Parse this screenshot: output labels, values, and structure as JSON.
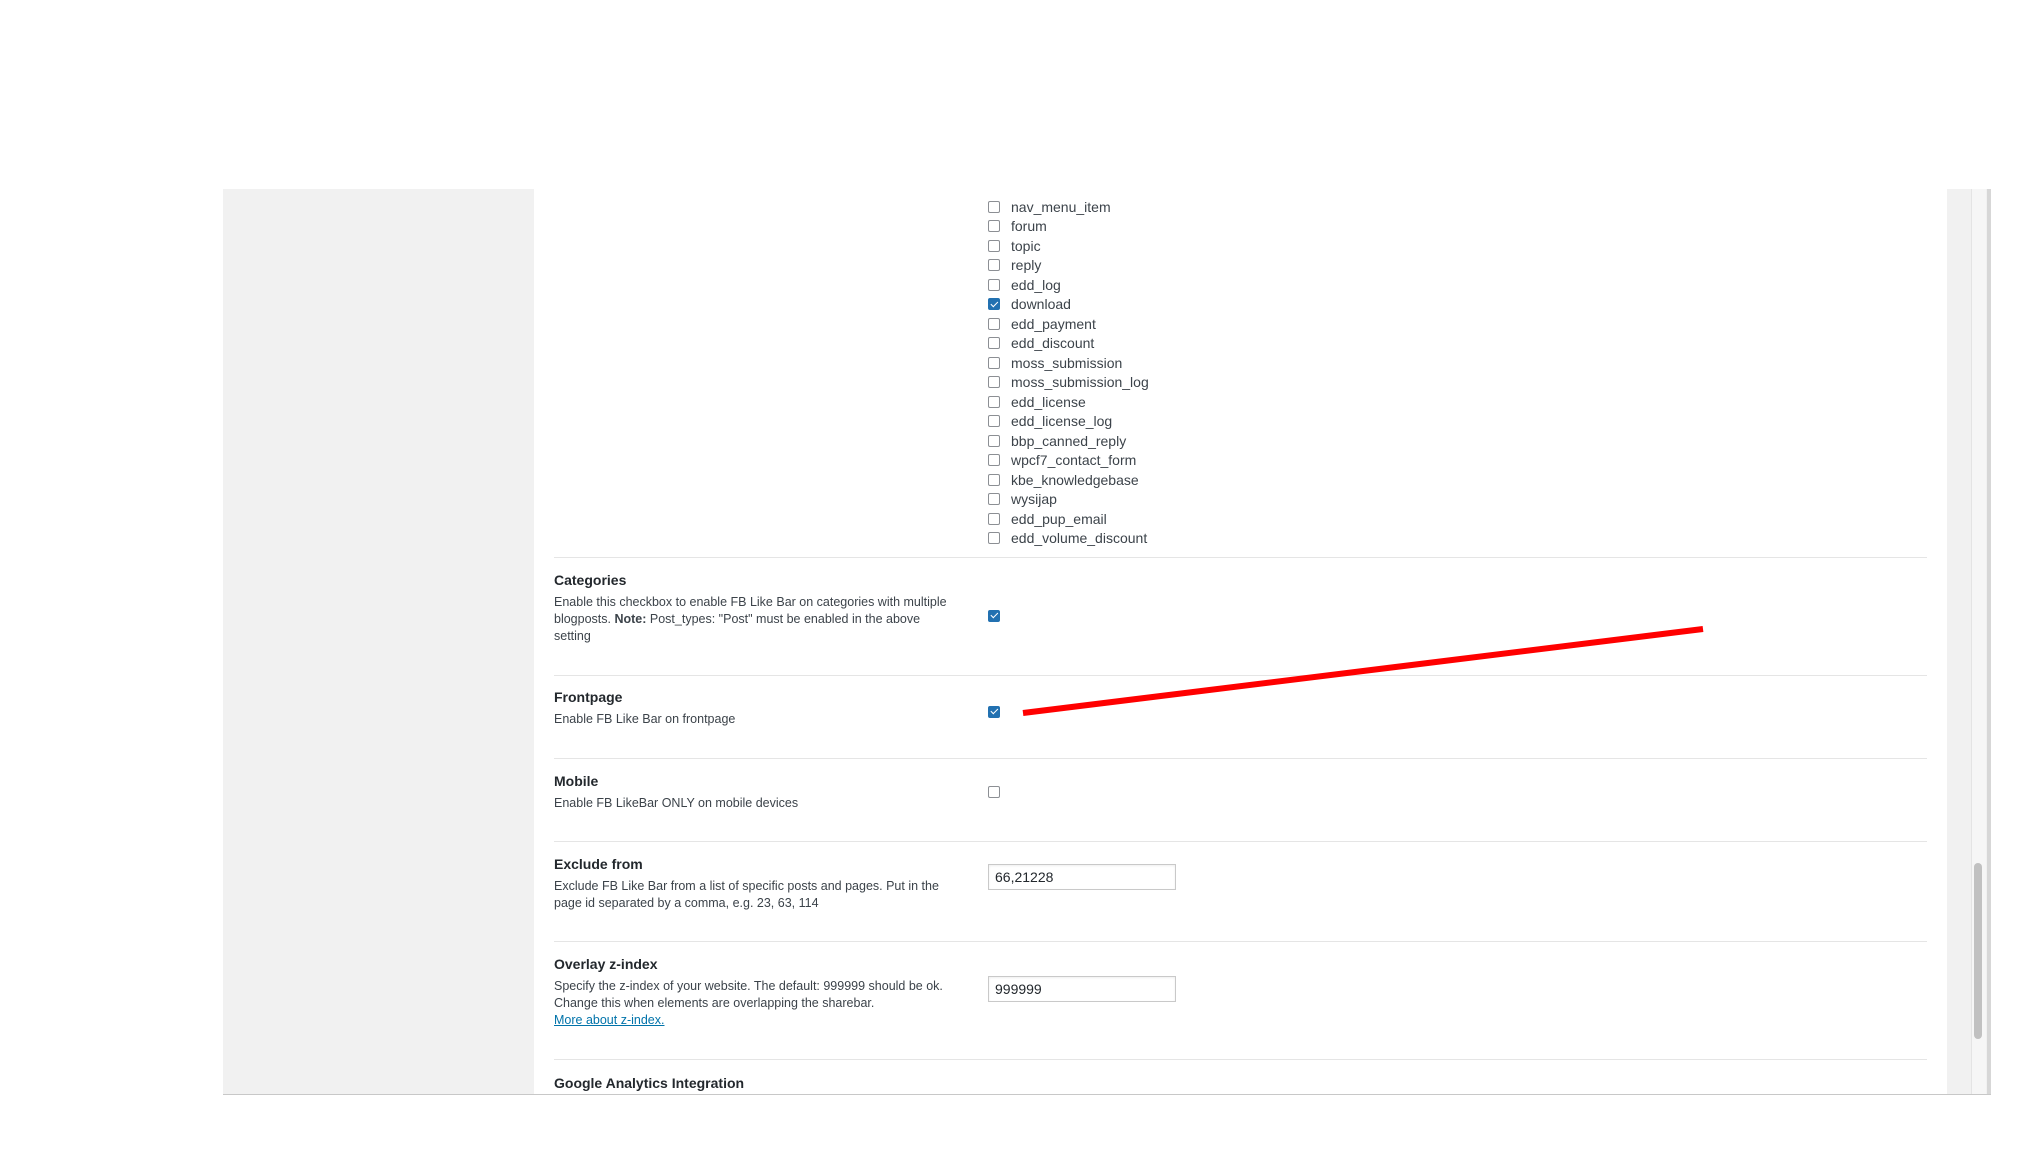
{
  "post_types": [
    {
      "label": "nav_menu_item",
      "checked": false
    },
    {
      "label": "forum",
      "checked": false
    },
    {
      "label": "topic",
      "checked": false
    },
    {
      "label": "reply",
      "checked": false
    },
    {
      "label": "edd_log",
      "checked": false
    },
    {
      "label": "download",
      "checked": true
    },
    {
      "label": "edd_payment",
      "checked": false
    },
    {
      "label": "edd_discount",
      "checked": false
    },
    {
      "label": "moss_submission",
      "checked": false
    },
    {
      "label": "moss_submission_log",
      "checked": false
    },
    {
      "label": "edd_license",
      "checked": false
    },
    {
      "label": "edd_license_log",
      "checked": false
    },
    {
      "label": "bbp_canned_reply",
      "checked": false
    },
    {
      "label": "wpcf7_contact_form",
      "checked": false
    },
    {
      "label": "kbe_knowledgebase",
      "checked": false
    },
    {
      "label": "wysijap",
      "checked": false
    },
    {
      "label": "edd_pup_email",
      "checked": false
    },
    {
      "label": "edd_volume_discount",
      "checked": false
    }
  ],
  "categories": {
    "title": "Categories",
    "desc_pre": "Enable this checkbox to enable FB Like Bar on categories with multiple blogposts. ",
    "desc_note": "Note:",
    "desc_post": " Post_types: \"Post\" must be enabled in the above setting",
    "checked": true
  },
  "frontpage": {
    "title": "Frontpage",
    "desc": "Enable FB Like Bar on frontpage",
    "checked": true
  },
  "mobile": {
    "title": "Mobile",
    "desc": "Enable FB LikeBar ONLY on mobile devices",
    "checked": false
  },
  "exclude_from": {
    "title": "Exclude from",
    "desc": "Exclude FB Like Bar from a list of specific posts and pages. Put in the page id separated by a comma, e.g. 23, 63, 114",
    "value": "66,21228"
  },
  "overlay_zindex": {
    "title": "Overlay z-index",
    "desc": "Specify the z-index of your website. The default: 999999 should be ok. Change this when elements are overlapping the sharebar.",
    "link": "More about z-index.",
    "value": "999999"
  },
  "google_analytics": {
    "title": "Google Analytics Integration"
  },
  "colors": {
    "accent": "#2271b1",
    "annotation_line": "#ff0000",
    "sidebar_bg": "#f1f1f1"
  }
}
